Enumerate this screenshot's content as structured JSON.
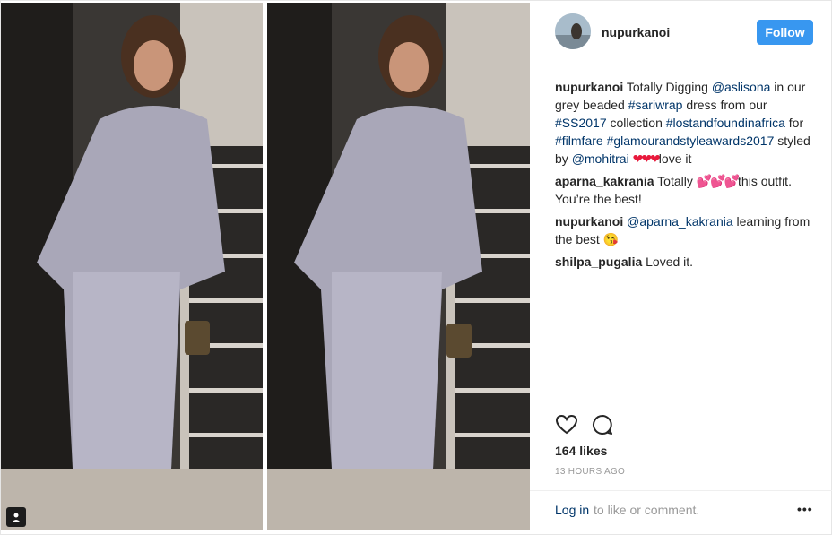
{
  "header": {
    "username": "nupurkanoi",
    "follow_label": "Follow"
  },
  "comments": [
    {
      "user": "nupurkanoi",
      "parts": [
        {
          "t": "text",
          "v": " Totally Digging "
        },
        {
          "t": "tag",
          "v": "@aslisona"
        },
        {
          "t": "text",
          "v": " in our grey beaded "
        },
        {
          "t": "tag",
          "v": "#sariwrap"
        },
        {
          "t": "text",
          "v": " dress from our "
        },
        {
          "t": "tag",
          "v": "#SS2017"
        },
        {
          "t": "text",
          "v": " collection "
        },
        {
          "t": "tag",
          "v": "#lostandfoundinafrica"
        },
        {
          "t": "text",
          "v": " for "
        },
        {
          "t": "tag",
          "v": "#filmfare"
        },
        {
          "t": "text",
          "v": " "
        },
        {
          "t": "tag",
          "v": "#glamourandstyleawards2017"
        },
        {
          "t": "text",
          "v": " styled by "
        },
        {
          "t": "tag",
          "v": "@mohitrai"
        },
        {
          "t": "text",
          "v": " "
        },
        {
          "t": "emoji",
          "v": "❤❤❤",
          "c": "red"
        },
        {
          "t": "text",
          "v": "love it"
        }
      ]
    },
    {
      "user": "aparna_kakrania",
      "parts": [
        {
          "t": "text",
          "v": " Totally "
        },
        {
          "t": "emoji",
          "v": "💕💕💕",
          "c": "pink"
        },
        {
          "t": "text",
          "v": "this outfit. You’re the best!"
        }
      ]
    },
    {
      "user": "nupurkanoi",
      "parts": [
        {
          "t": "text",
          "v": " "
        },
        {
          "t": "tag",
          "v": "@aparna_kakrania"
        },
        {
          "t": "text",
          "v": " learning from the best "
        },
        {
          "t": "emoji",
          "v": "😘",
          "c": "face"
        }
      ]
    },
    {
      "user": "shilpa_pugalia",
      "parts": [
        {
          "t": "text",
          "v": " Loved it."
        }
      ]
    }
  ],
  "actions": {
    "like_icon": "heart-outline-icon",
    "comment_icon": "speech-bubble-icon"
  },
  "likes": "164 likes",
  "time": "13 HOURS AGO",
  "login": {
    "link": "Log in",
    "rest": "to like or comment.",
    "more": "•••"
  }
}
